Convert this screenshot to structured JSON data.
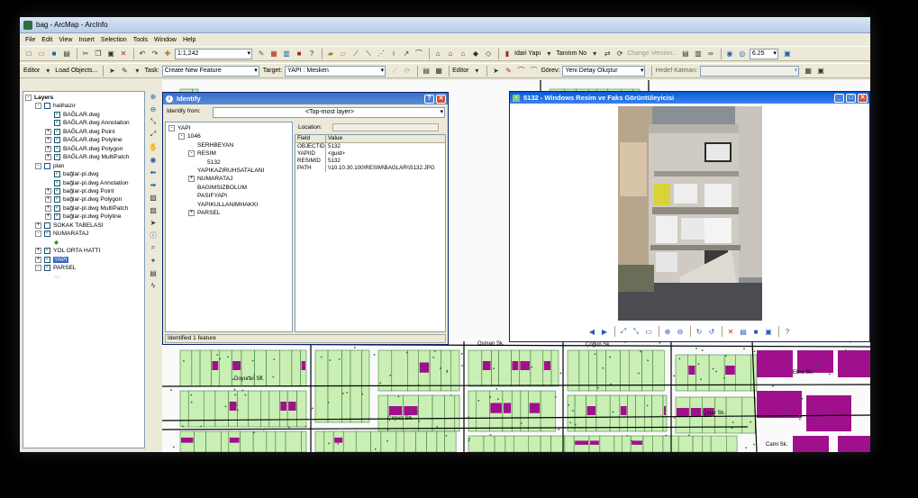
{
  "window": {
    "title": "bag - ArcMap - ArcInfo"
  },
  "menu": [
    "File",
    "Edit",
    "View",
    "Insert",
    "Selection",
    "Tools",
    "Window",
    "Help"
  ],
  "toolbar1": {
    "scale": "1:1,242",
    "layer_combo": "Idari Yapı",
    "tanitim": "Tanıtım No",
    "change_version": "Change Version...",
    "zoom_value": "6.25"
  },
  "toolbar2": {
    "editor": "Editor",
    "load_objects": "Load Objects...",
    "task_label": "Task:",
    "task_value": "Create New Feature",
    "target_label": "Target:",
    "target_value": "YAPI : Mesken",
    "editor2": "Editor",
    "gorev_label": "Görev:",
    "gorev_value": "Yeni Detay Oluştur",
    "hedef_label": "Hedef Katman:",
    "hedef_value": ""
  },
  "toc": {
    "rows": [
      {
        "label": "Layers",
        "level": 0,
        "exp": "-",
        "chk": null,
        "bold": true
      },
      {
        "label": "halihazır",
        "level": 1,
        "exp": "-",
        "chk": false
      },
      {
        "label": "BAĞLAR.dwg",
        "level": 2,
        "exp": "",
        "chk": true
      },
      {
        "label": "BAĞLAR.dwg Annotation",
        "level": 2,
        "exp": "",
        "chk": true
      },
      {
        "label": "BAĞLAR.dwg Point",
        "level": 2,
        "exp": "+",
        "chk": true
      },
      {
        "label": "BAĞLAR.dwg Polyline",
        "level": 2,
        "exp": "+",
        "chk": true
      },
      {
        "label": "BAĞLAR.dwg Polygon",
        "level": 2,
        "exp": "+",
        "chk": true
      },
      {
        "label": "BAĞLAR.dwg MultiPatch",
        "level": 2,
        "exp": "+",
        "chk": true
      },
      {
        "label": "plan",
        "level": 1,
        "exp": "-",
        "chk": false
      },
      {
        "label": "bağlar-pl.dwg",
        "level": 2,
        "exp": "",
        "chk": true
      },
      {
        "label": "bağlar-pl.dwg Annotation",
        "level": 2,
        "exp": "",
        "chk": true
      },
      {
        "label": "bağlar-pl.dwg Point",
        "level": 2,
        "exp": "+",
        "chk": true
      },
      {
        "label": "bağlar-pl.dwg Polygon",
        "level": 2,
        "exp": "+",
        "chk": true
      },
      {
        "label": "bağlar-pl.dwg MultiPatch",
        "level": 2,
        "exp": "+",
        "chk": true
      },
      {
        "label": "bağlar-pl.dwg Polyline",
        "level": 2,
        "exp": "+",
        "chk": true
      },
      {
        "label": "SOKAK TABELASI",
        "level": 1,
        "exp": "+",
        "chk": false
      },
      {
        "label": "NUMARATAJ",
        "level": 1,
        "exp": "-",
        "chk": true
      },
      {
        "label": "◆",
        "level": 2,
        "exp": "",
        "chk": null
      },
      {
        "label": "YOL ORTA HATTI",
        "level": 1,
        "exp": "+",
        "chk": true
      },
      {
        "label": "YAPI",
        "level": 1,
        "exp": "+",
        "chk": true,
        "selected": true
      },
      {
        "label": "PARSEL",
        "level": 1,
        "exp": "-",
        "chk": true
      },
      {
        "label": "▭",
        "level": 2,
        "exp": "",
        "chk": null
      }
    ]
  },
  "identify": {
    "title": "Identify",
    "from_label": "Identify from:",
    "from_value": "<Top-most layer>",
    "tree": [
      {
        "label": "YAPI",
        "level": 0,
        "exp": "-"
      },
      {
        "label": "1046",
        "level": 1,
        "exp": "-"
      },
      {
        "label": "SERHBEYAN",
        "level": 2,
        "exp": ""
      },
      {
        "label": "RESIM",
        "level": 2,
        "exp": "-"
      },
      {
        "label": "5132",
        "level": 3,
        "exp": ""
      },
      {
        "label": "YAPIKAZIRUHSATALANI",
        "level": 2,
        "exp": ""
      },
      {
        "label": "NUMARATAJ",
        "level": 2,
        "exp": "+"
      },
      {
        "label": "BAGIMSIZBOLUM",
        "level": 2,
        "exp": ""
      },
      {
        "label": "PASIFYAPI",
        "level": 2,
        "exp": ""
      },
      {
        "label": "YAPIKULLANIMHAKKI",
        "level": 2,
        "exp": ""
      },
      {
        "label": "PARSEL",
        "level": 2,
        "exp": "+"
      }
    ],
    "location_label": "Location:",
    "columns": [
      "Field",
      "Value"
    ],
    "rows": [
      [
        "OBJECTID",
        "5132"
      ],
      [
        "YAPIID",
        "<guid>"
      ],
      [
        "RESIMID",
        "5132"
      ],
      [
        "PATH",
        "\\\\10.10.30.100\\RESIM\\BAGLAR\\\\5132.JPG"
      ]
    ],
    "status": "Identified 1 feature"
  },
  "viewer": {
    "title": "5132 - Windows Resim ve Faks Görüntüleyicisi"
  },
  "map_labels": [
    "Doyuran Sk.",
    "Ebru Sk.",
    "Cami Sk.",
    "Çoğun Sk.",
    "Çınar Sk.",
    "Çırpıcı Sk.",
    "Osman Sk."
  ],
  "colors": {
    "parcel": "#c9efb4",
    "building": "#a0108c",
    "line": "#000000",
    "title_blue": "#3a70c8"
  }
}
